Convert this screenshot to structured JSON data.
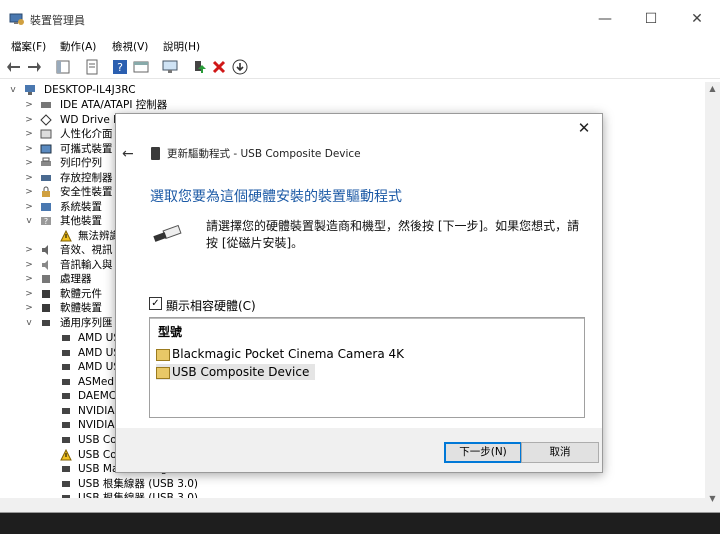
{
  "window": {
    "title": "裝置管理員",
    "minimize": "—",
    "maximize": "☐",
    "close": "✕"
  },
  "menu": [
    "檔案(F)",
    "動作(A)",
    "檢視(V)",
    "說明(H)"
  ],
  "tree": {
    "root": "DESKTOP-IL4J3RC",
    "items": [
      "IDE ATA/ATAPI 控制器",
      "WD Drive M",
      "人性化介面",
      "可攜式裝置",
      "列印佇列",
      "存放控制器",
      "安全性裝置",
      "系統裝置",
      "其他裝置",
      "無法辨識",
      "音效、視訊",
      "音訊輸入與",
      "處理器",
      "軟體元件",
      "軟體裝置",
      "通用序列匯"
    ],
    "usb_children": [
      "AMD US",
      "AMD US",
      "AMD US",
      "ASMedi",
      "DAEMC",
      "NVIDIA",
      "NVIDIA",
      "USB Co",
      "USB Co",
      "USB Mass Storage Device",
      "USB 根集線器 (USB 3.0)",
      "USB 根集線器 (USB 3.0)"
    ]
  },
  "dialog": {
    "header": "更新驅動程式 - USB Composite Device",
    "heading": "選取您要為這個硬體安裝的裝置驅動程式",
    "instruction": "請選擇您的硬體裝置製造商和機型，然後按 [下一步]。如果您想式，請按 [從磁片安裝]。",
    "show_compatible": "顯示相容硬體(C)",
    "column_header": "型號",
    "models": [
      "Blackmagic Pocket Cinema Camera 4K",
      "USB Composite Device"
    ],
    "selected_index": 1,
    "next_button": "下一步(N)",
    "cancel_button": "取消"
  },
  "colors": {
    "accent": "#0078d7",
    "heading": "#1c5aa6"
  }
}
